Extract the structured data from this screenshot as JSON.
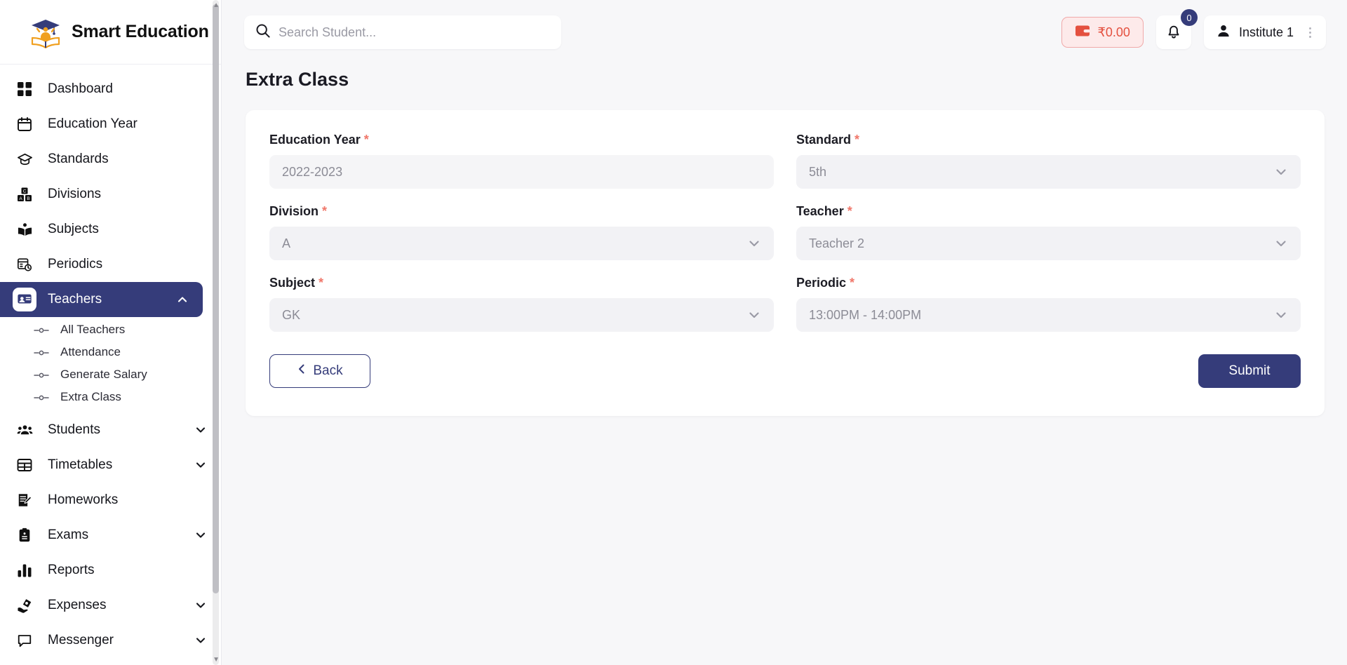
{
  "brand": {
    "name": "Smart Education",
    "logo_icon": "graduation-logo-icon"
  },
  "sidebar": {
    "items": [
      {
        "label": "Dashboard",
        "icon": "grid-icon",
        "expandable": false
      },
      {
        "label": "Education Year",
        "icon": "calendar-icon",
        "expandable": false
      },
      {
        "label": "Standards",
        "icon": "graduation-cap-icon",
        "expandable": false
      },
      {
        "label": "Divisions",
        "icon": "blocks-icon",
        "expandable": false
      },
      {
        "label": "Subjects",
        "icon": "open-book-icon",
        "expandable": false
      },
      {
        "label": "Periodics",
        "icon": "schedule-clock-icon",
        "expandable": false
      },
      {
        "label": "Teachers",
        "icon": "teacher-board-icon",
        "expandable": true,
        "expanded": true,
        "active": true
      },
      {
        "label": "Students",
        "icon": "users-icon",
        "expandable": true,
        "expanded": false
      },
      {
        "label": "Timetables",
        "icon": "table-icon",
        "expandable": true,
        "expanded": false
      },
      {
        "label": "Homeworks",
        "icon": "note-edit-icon",
        "expandable": false
      },
      {
        "label": "Exams",
        "icon": "clipboard-icon",
        "expandable": true,
        "expanded": false
      },
      {
        "label": "Reports",
        "icon": "bar-chart-icon",
        "expandable": false
      },
      {
        "label": "Expenses",
        "icon": "hand-money-icon",
        "expandable": true,
        "expanded": false
      },
      {
        "label": "Messenger",
        "icon": "chat-bubble-icon",
        "expandable": true,
        "expanded": false
      }
    ],
    "teachers_submenu": [
      {
        "label": "All Teachers"
      },
      {
        "label": "Attendance"
      },
      {
        "label": "Generate Salary"
      },
      {
        "label": "Extra Class",
        "active": true
      }
    ]
  },
  "topbar": {
    "search": {
      "placeholder": "Search Student...",
      "value": "",
      "icon": "search-icon"
    },
    "wallet": {
      "amount": "₹0.00",
      "icon": "wallet-icon"
    },
    "notifications": {
      "count": "0",
      "icon": "bell-icon"
    },
    "account": {
      "name": "Institute 1",
      "icon": "user-icon",
      "menu_icon": "kebab-menu-icon"
    }
  },
  "page": {
    "title": "Extra Class"
  },
  "form": {
    "fields": [
      {
        "label": "Education Year",
        "required": "*",
        "value": "2022-2023",
        "type": "text",
        "readonly": true
      },
      {
        "label": "Standard",
        "required": "*",
        "value": "5th",
        "type": "select"
      },
      {
        "label": "Division",
        "required": "*",
        "value": "A",
        "type": "select"
      },
      {
        "label": "Teacher",
        "required": "*",
        "value": "Teacher 2",
        "type": "select"
      },
      {
        "label": "Subject",
        "required": "*",
        "value": "GK",
        "type": "select"
      },
      {
        "label": "Periodic",
        "required": "*",
        "value": "13:00PM - 14:00PM",
        "type": "select"
      }
    ],
    "back_label": "Back",
    "submit_label": "Submit"
  },
  "colors": {
    "accent_navy": "#353c7a",
    "wallet_red": "#e4503f",
    "required_red": "#f0776a",
    "page_bg": "#f7f7f9",
    "field_bg": "#f2f2f5"
  }
}
